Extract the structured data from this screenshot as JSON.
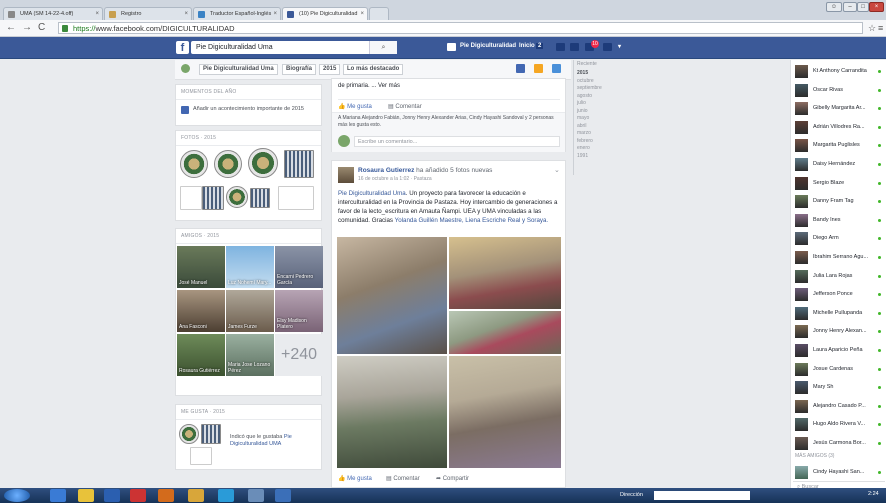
{
  "browser": {
    "tabs": [
      {
        "label": "UMA (SM 14-22-4.off)"
      },
      {
        "label": "Registro"
      },
      {
        "label": "Traductor Español-Inglés"
      },
      {
        "label": "(10) Pie Digiculturalidad"
      }
    ],
    "url_scheme": "https://",
    "url_host": "www.facebook.com",
    "url_path": "/DIGICULTURALIDAD"
  },
  "fb": {
    "search_value": "Pie Digiculturalidad Uma",
    "page_name": "Pie Digiculturalidad",
    "home_label": "Inicio",
    "home_count": "2",
    "notif_count": "10"
  },
  "timeline": {
    "page_btn": "Pie Digiculturalidad Uma",
    "section_btn": "Biografía",
    "year_btn": "2015",
    "filter_btn": "Lo más destacado"
  },
  "years": {
    "title": "Reciente",
    "items": [
      "2015",
      "octubre",
      "septiembre",
      "agosto",
      "julio",
      "junio",
      "mayo",
      "abril",
      "marzo",
      "febrero",
      "enero",
      "1991"
    ]
  },
  "left": {
    "moments_title": "MOMENTOS DEL AÑO",
    "moments_action": "Añadir un acontecimiento importante de 2015",
    "photos_title": "FOTOS · 2015",
    "friends_title": "AMIGOS · 2015",
    "friends": [
      {
        "name": "José Manuel"
      },
      {
        "name": "Luz Nohemí Mary..."
      },
      {
        "name": "Encarni Pedrero García"
      },
      {
        "name": "Ana Fasconi"
      },
      {
        "name": "James Furze"
      },
      {
        "name": "Elsy Madison Platero"
      },
      {
        "name": "Rosaura Gutiérrez"
      },
      {
        "name": "Maria Jose Lozano Pérez"
      }
    ],
    "friends_more": "+240",
    "likes_title": "ME GUSTA · 2015",
    "likes_text_pre": "Indicó que le gustaba ",
    "likes_text_link": "Pie Digiculturalidad UMA"
  },
  "post1": {
    "text_tail": "de primaria. ... Ver más",
    "like": "Me gusta",
    "comment": "Comentar",
    "likers": "A Mariana Alejandro Fabián, Jonny Henry Alexander Arias, Cindy Hayashi Sandoval y 2 personas más les gusta esto.",
    "comment_placeholder": "Escribe un comentario..."
  },
  "post2": {
    "author": "Rosaura Gutierrez",
    "action": "ha añadido 5 fotos nuevas",
    "meta": "16 de octubre a la 1:02 · Pastaza",
    "text_link": "Pie Digiculturalidad Uma",
    "text_body": ". Un proyecto para favorecer la educación e interculturalidad en la Provincia de Pastaza. Hoy intercambio de generaciones a favor de la lecto_escritura en Amauta Ñampi. UEA y UMA vinculadas a las comunidad. Gracias ",
    "text_tags": "Yolanda Guillén Maestre, Liena Escriche Real y Soraya.",
    "like": "Me gusta",
    "comment": "Comentar",
    "share": "Compartir"
  },
  "chat": {
    "contacts": [
      "Kt Anthony Carrandita",
      "Oscar Rivas",
      "Gibelly Margarita Ar...",
      "Adrián Villodres Ra...",
      "Margarita Puglisles",
      "Daisy Hernández",
      "Sergio Blaze",
      "Danny Fram Tag",
      "Bandy Ines",
      "Diego Arm",
      "Ibrahim Serrano Agu...",
      "Julia Lara Rojas",
      "Jefferson Ponce",
      "Michelle Pullupanda",
      "Jonny Henry Alexan...",
      "Laura Aparicio Peña",
      "Josue Cardenas",
      "Mary Sh",
      "Alejandro Casado P...",
      "Hugo Aldo Rivera V...",
      "Jesús Carmona Bor..."
    ],
    "more_title": "MÁS AMIGOS (3)",
    "more_contact": "Cindy Hayashi San...",
    "search_placeholder": "Buscar"
  },
  "taskbar": {
    "address_label": "Dirección",
    "clock": "2:24"
  }
}
